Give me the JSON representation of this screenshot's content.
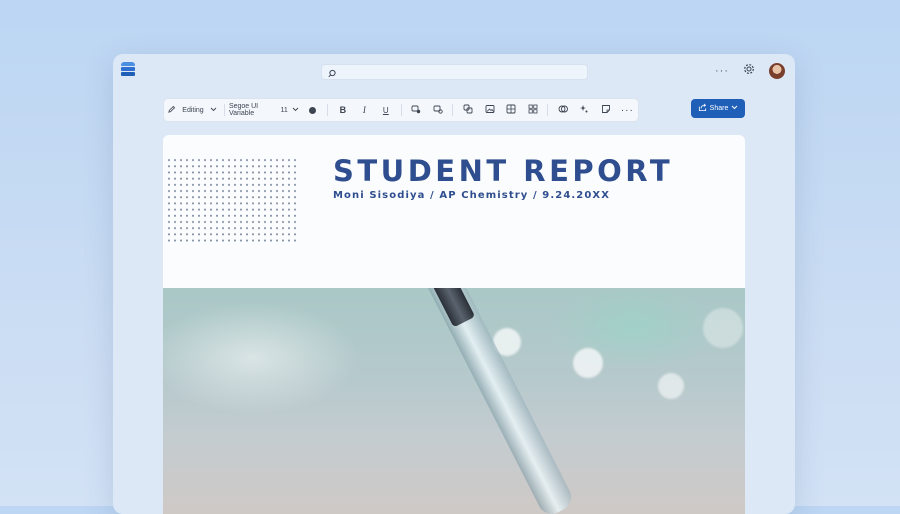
{
  "window": {
    "search_placeholder": "",
    "more_label": "···"
  },
  "toolbar": {
    "mode_label": "Editing",
    "font_name": "Segoe UI Variable",
    "font_size": "11",
    "bold_label": "B",
    "italic_label": "I",
    "underline_label": "U",
    "more_label": "···"
  },
  "share": {
    "label": "Share"
  },
  "document": {
    "title": "STUDENT REPORT",
    "subtitle": "Moni Sisodiya  /  AP Chemistry  /  9.24.20XX"
  },
  "colors": {
    "accent": "#1f5fb8",
    "title_color": "#2f4e8f",
    "app_icon": [
      "#4a8fe0",
      "#2f6fcf",
      "#1f5fb8"
    ]
  },
  "icons": {
    "app": "word-app-icon",
    "search": "search-icon",
    "settings": "gear-icon",
    "mode": "pencil-icon"
  }
}
